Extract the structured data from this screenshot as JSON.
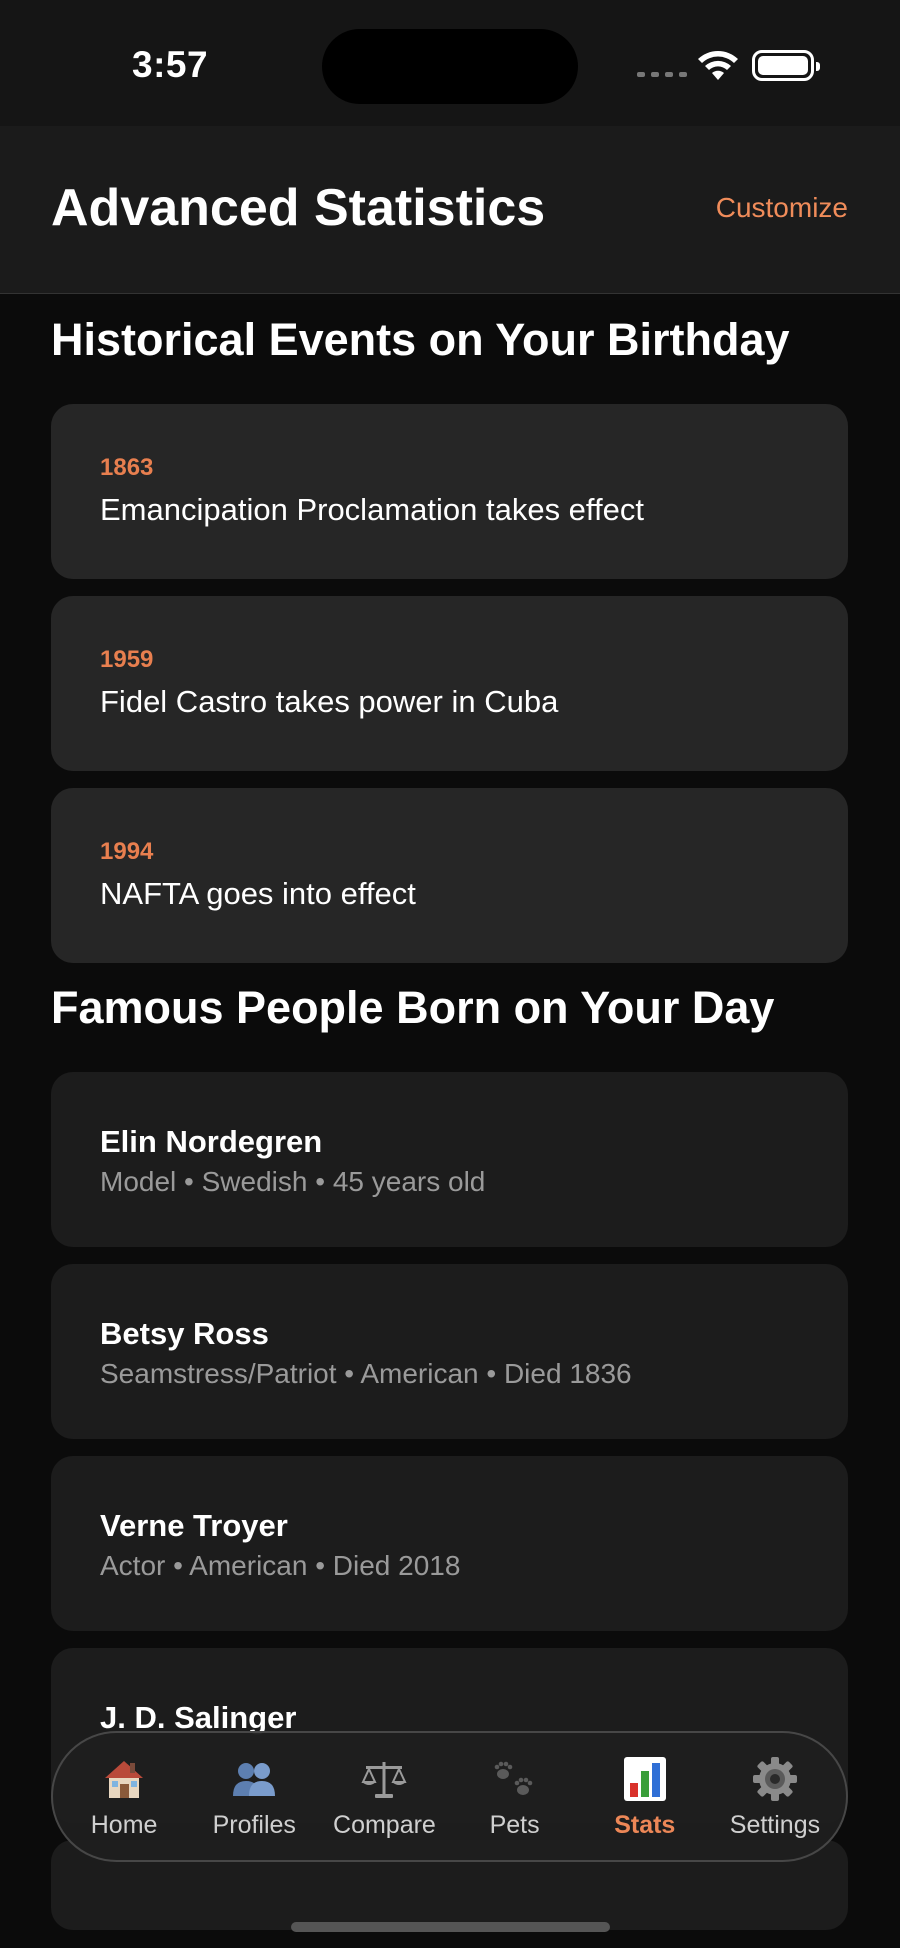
{
  "status_bar": {
    "time": "3:57"
  },
  "header": {
    "title": "Advanced Statistics",
    "action_label": "Customize"
  },
  "events_section": {
    "title": "Historical Events on Your Birthday",
    "items": [
      {
        "year": "1863",
        "text": "Emancipation Proclamation takes effect"
      },
      {
        "year": "1959",
        "text": "Fidel Castro takes power in Cuba"
      },
      {
        "year": "1994",
        "text": "NAFTA goes into effect"
      }
    ]
  },
  "people_section": {
    "title": "Famous People Born on Your Day",
    "items": [
      {
        "name": "Elin Nordegren",
        "meta": "Model • Swedish • 45 years old"
      },
      {
        "name": "Betsy Ross",
        "meta": "Seamstress/Patriot • American • Died 1836"
      },
      {
        "name": "Verne Troyer",
        "meta": "Actor • American • Died 2018"
      },
      {
        "name": "J. D. Salinger",
        "meta": ""
      }
    ]
  },
  "tab_bar": {
    "tabs": [
      {
        "label": "Home",
        "icon": "house-icon"
      },
      {
        "label": "Profiles",
        "icon": "people-icon"
      },
      {
        "label": "Compare",
        "icon": "scales-icon"
      },
      {
        "label": "Pets",
        "icon": "paw-prints-icon"
      },
      {
        "label": "Stats",
        "icon": "bar-chart-icon"
      },
      {
        "label": "Settings",
        "icon": "gear-icon"
      }
    ],
    "active": "Stats",
    "accent_color": "#ec8757"
  }
}
